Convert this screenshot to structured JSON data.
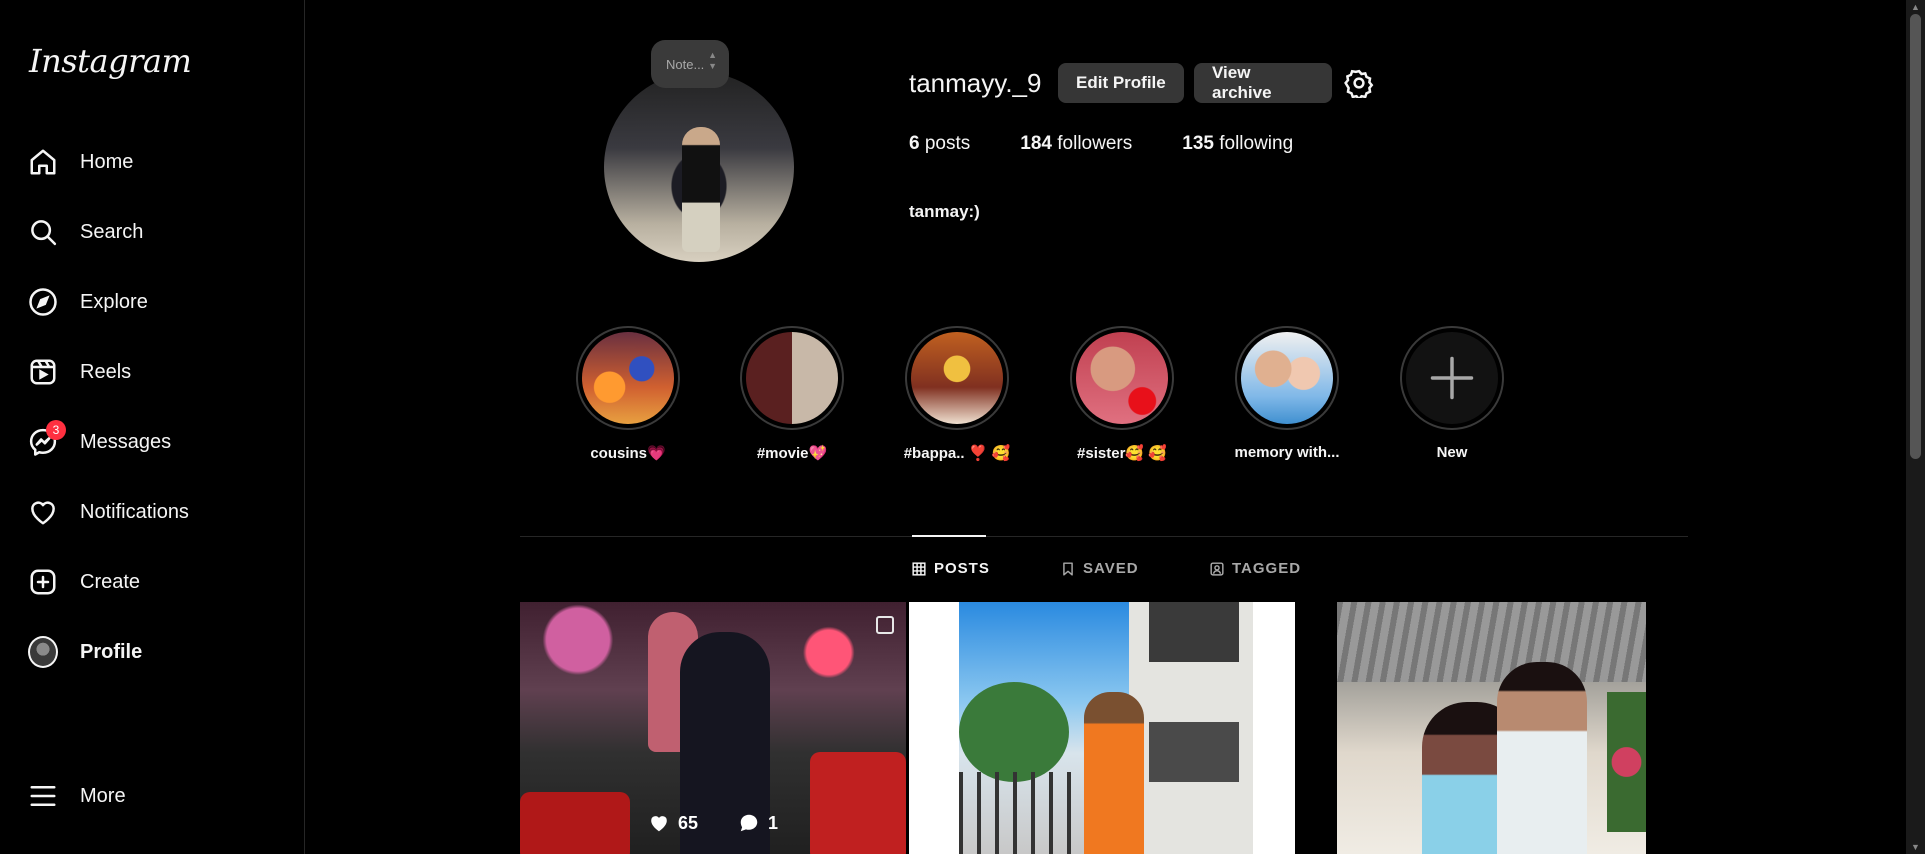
{
  "app": {
    "logo": "Instagram"
  },
  "sidebar": {
    "items": [
      {
        "label": "Home",
        "icon": "home-icon"
      },
      {
        "label": "Search",
        "icon": "search-icon"
      },
      {
        "label": "Explore",
        "icon": "compass-icon"
      },
      {
        "label": "Reels",
        "icon": "reels-icon"
      },
      {
        "label": "Messages",
        "icon": "messenger-icon",
        "badge": "3"
      },
      {
        "label": "Notifications",
        "icon": "heart-icon"
      },
      {
        "label": "Create",
        "icon": "plus-square-icon"
      },
      {
        "label": "Profile",
        "icon": "avatar"
      }
    ],
    "more": "More"
  },
  "profile": {
    "note_placeholder": "Note...",
    "username": "tanmayy._9",
    "edit_button": "Edit Profile",
    "archive_button": "View archive",
    "posts_count": "6",
    "posts_label": "posts",
    "followers_count": "184",
    "followers_label": "followers",
    "following_count": "135",
    "following_label": "following",
    "bio": "tanmay:)"
  },
  "highlights": [
    {
      "label": "cousins💗"
    },
    {
      "label": "#movie💖"
    },
    {
      "label": "#bappa.. ❣️ 🥰"
    },
    {
      "label": "#sister🥰 🥰"
    },
    {
      "label": "memory with..."
    },
    {
      "label": "New"
    }
  ],
  "tabs": {
    "posts": "POSTS",
    "saved": "SAVED",
    "tagged": "TAGGED"
  },
  "posts": [
    {
      "likes": "65",
      "comments": "1"
    }
  ],
  "colors": {
    "background": "#000000",
    "button_bg": "#363636",
    "badge": "#ff3040",
    "divider": "#262626"
  }
}
